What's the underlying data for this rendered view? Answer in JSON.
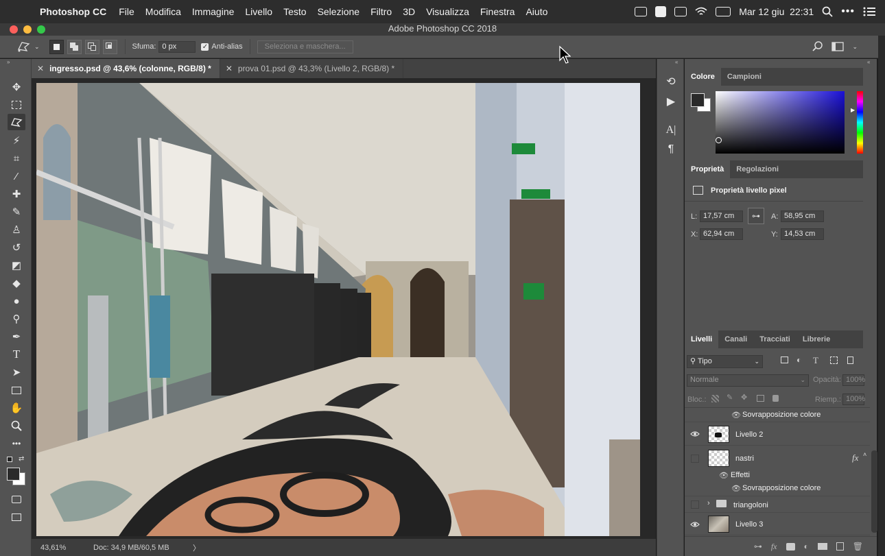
{
  "menubar": {
    "app_name": "Photoshop CC",
    "items": [
      "File",
      "Modifica",
      "Immagine",
      "Livello",
      "Testo",
      "Selezione",
      "Filtro",
      "3D",
      "Visualizza",
      "Finestra",
      "Aiuto"
    ],
    "datetime": "Mar 12 giu  22:31"
  },
  "window": {
    "title": "Adobe Photoshop CC 2018"
  },
  "options": {
    "feather_label": "Sfuma:",
    "feather_value": "0 px",
    "antialias_label": "Anti-alias",
    "antialias_checked": true,
    "select_mask_label": "Seleziona e maschera..."
  },
  "tabs": [
    {
      "label": "ingresso.psd @ 43,6% (colonne, RGB/8) *",
      "active": true
    },
    {
      "label": "prova 01.psd @ 43,3% (Livello 2, RGB/8) *",
      "active": false
    }
  ],
  "status": {
    "zoom": "43,61%",
    "doc": "Doc: 34,9 MB/60,5 MB",
    "arrow": "〉"
  },
  "color_panel": {
    "tab_active": "Colore",
    "tab_other": "Campioni",
    "hue_accent": "#1a10d8"
  },
  "properties_panel": {
    "tab_active": "Proprietà",
    "tab_other": "Regolazioni",
    "header": "Proprietà livello pixel",
    "w_label": "L:",
    "w_value": "17,57 cm",
    "h_label": "A:",
    "h_value": "58,95 cm",
    "x_label": "X:",
    "x_value": "62,94 cm",
    "y_label": "Y:",
    "y_value": "14,53 cm"
  },
  "layers_panel": {
    "tabs": [
      "Livelli",
      "Canali",
      "Tracciati",
      "Librerie"
    ],
    "filter_label": "Tipo",
    "blend_mode": "Normale",
    "opacity_label": "Opacità:",
    "opacity_value": "100%",
    "lock_label": "Bloc.:",
    "fill_label": "Riemp.:",
    "fill_value": "100%",
    "rows": {
      "effect_top": "Sovrapposizione colore",
      "layer2": "Livello 2",
      "nastri": "nastri",
      "fx": "fx",
      "effects": "Effetti",
      "effect_nastri": "Sovrapposizione colore",
      "group": "triangoloni",
      "layer3": "Livello 3"
    }
  }
}
